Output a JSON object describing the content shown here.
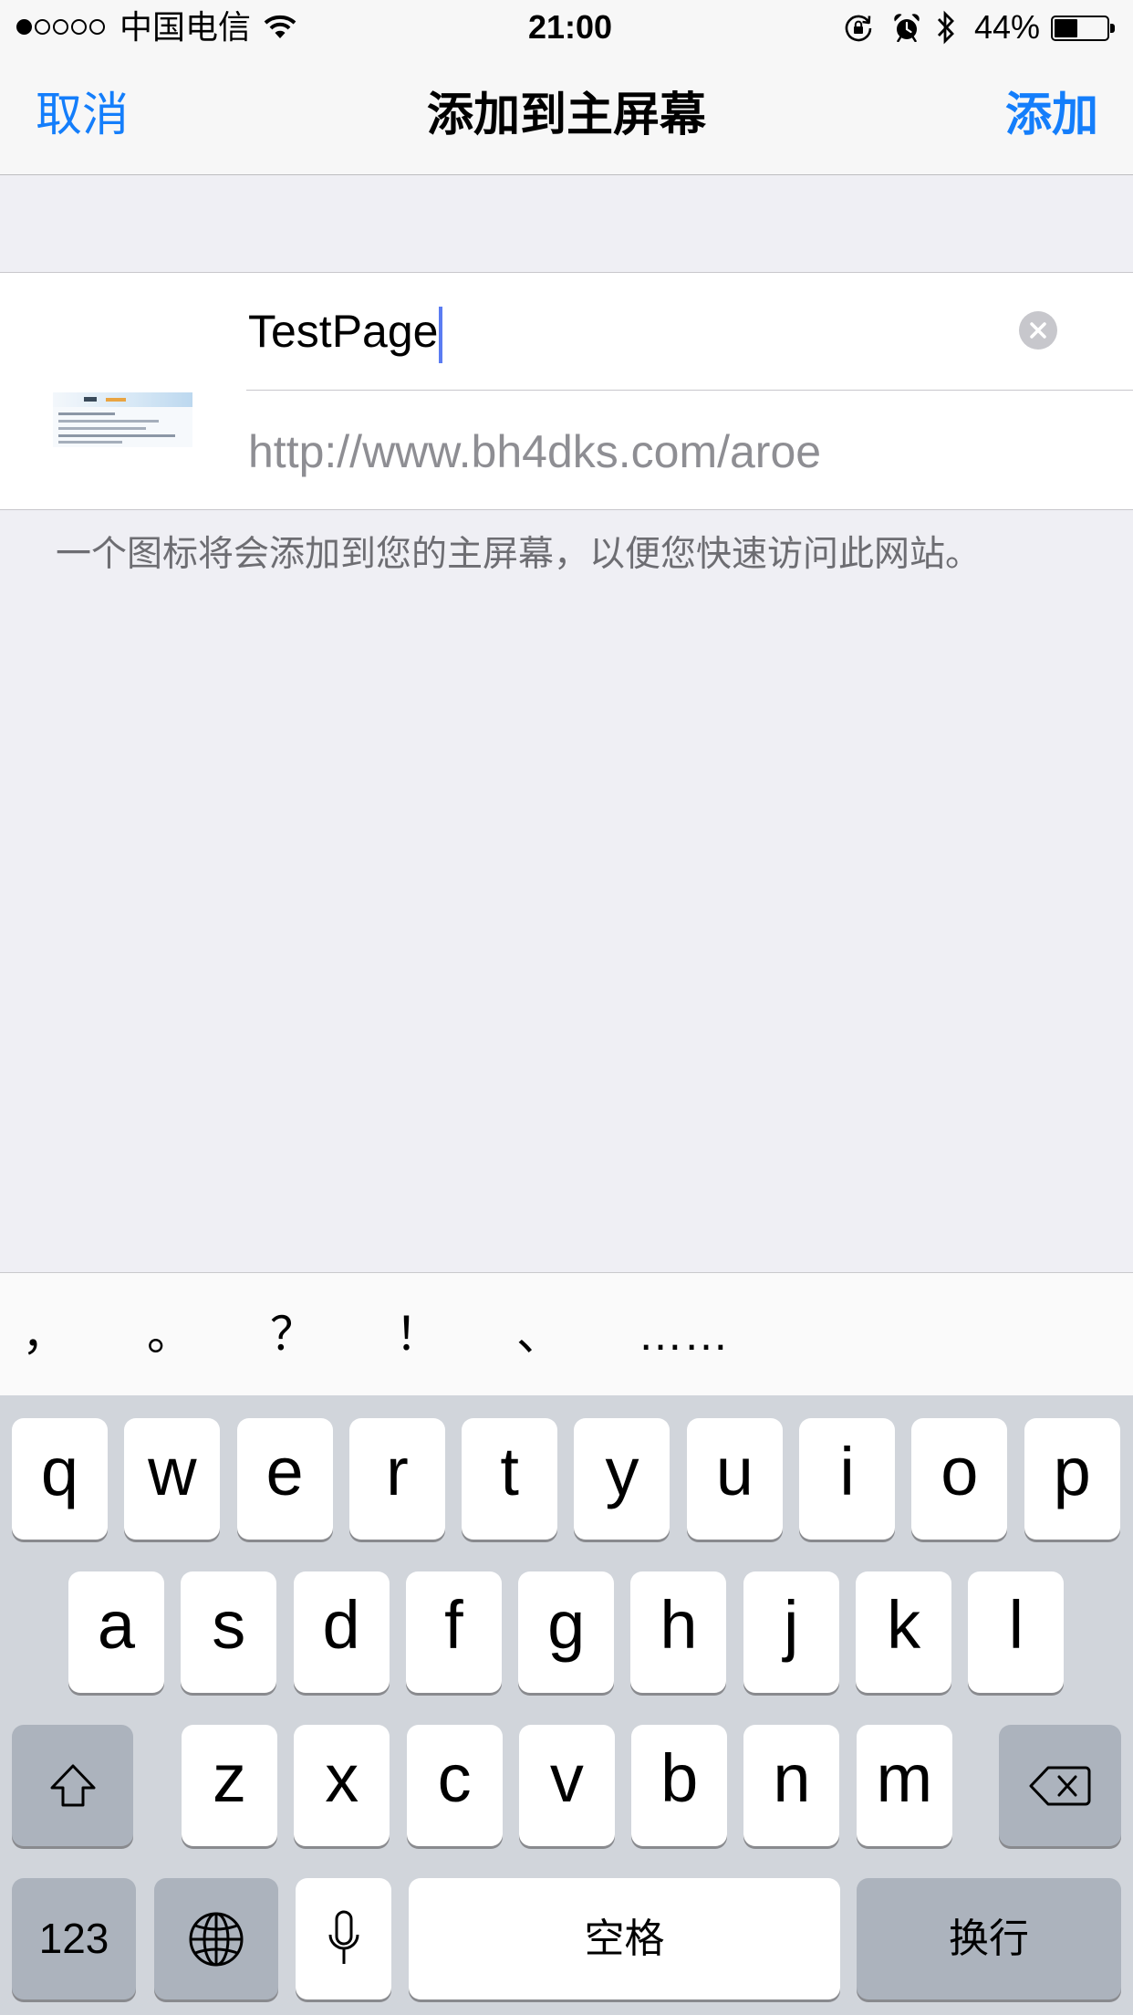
{
  "status_bar": {
    "signal_strength": 1,
    "signal_max": 5,
    "carrier": "中国电信",
    "time": "21:00",
    "battery_label": "44%",
    "battery_level": 0.44,
    "icons": {
      "wifi": "wifi-icon",
      "orientation_lock": "orientation-lock-icon",
      "alarm": "alarm-icon",
      "bluetooth": "bluetooth-icon",
      "battery": "battery-icon"
    }
  },
  "nav_bar": {
    "cancel_label": "取消",
    "title": "添加到主屏幕",
    "add_label": "添加"
  },
  "form": {
    "title_value": "TestPage",
    "url": "http://www.bh4dks.com/aroe",
    "footer_note": "一个图标将会添加到您的主屏幕，以便您快速访问此网站。",
    "icons": {
      "clear": "clear-circle-icon"
    }
  },
  "keyboard": {
    "punctuation": [
      "，",
      "。",
      "？",
      "！",
      "、",
      "……"
    ],
    "rows": [
      [
        "q",
        "w",
        "e",
        "r",
        "t",
        "y",
        "u",
        "i",
        "o",
        "p"
      ],
      [
        "a",
        "s",
        "d",
        "f",
        "g",
        "h",
        "j",
        "k",
        "l"
      ],
      [
        "z",
        "x",
        "c",
        "v",
        "b",
        "n",
        "m"
      ]
    ],
    "numbers_label": "123",
    "space_label": "空格",
    "return_label": "换行",
    "icons": {
      "shift": "shift-icon",
      "delete": "delete-icon",
      "globe": "globe-icon",
      "microphone": "microphone-icon"
    }
  },
  "colors": {
    "accent": "#147efb",
    "caret": "#5b7cf2",
    "keyboard_background": "#d1d5db",
    "special_key": "#acb3bd",
    "footer_text": "#6d6d72",
    "url_text": "#8e8e93"
  }
}
